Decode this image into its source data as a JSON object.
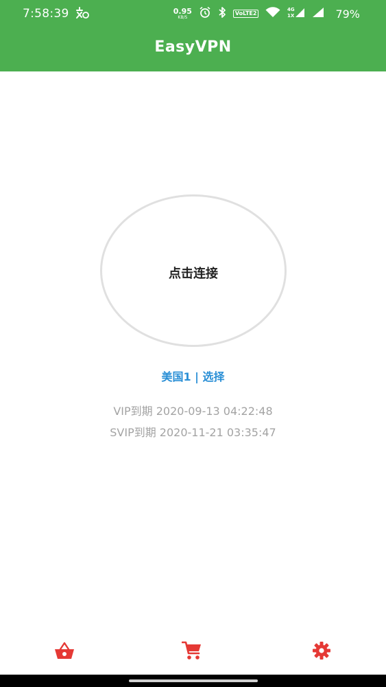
{
  "status_bar": {
    "time": "7:58:39",
    "net_speed_value": "0.95",
    "net_speed_unit": "KB/S",
    "volte_label": "VoLTE2",
    "battery_percent": "79%",
    "icons": [
      "app-notification-icon",
      "alarm-icon",
      "bluetooth-icon",
      "wifi-icon",
      "signal-4g-icon",
      "signal-icon"
    ]
  },
  "app_bar": {
    "title": "EasyVPN"
  },
  "connect": {
    "label": "点击连接"
  },
  "server": {
    "selection_text": "美国1 | 选择"
  },
  "membership": {
    "vip_line": "VIP到期 2020-09-13 04:22:48",
    "svip_line": "SVIP到期 2020-11-21 03:35:47"
  },
  "bottom_nav": {
    "items": [
      {
        "name": "shop-basket",
        "icon": "basket-icon"
      },
      {
        "name": "cart",
        "icon": "shopping-cart-icon"
      },
      {
        "name": "settings",
        "icon": "gear-icon"
      }
    ],
    "accent_color": "#e53935"
  },
  "colors": {
    "app_bar": "#4caf50",
    "link": "#2a8fd6",
    "muted_text": "#a3a3a3",
    "ring_border": "#e0e0e0"
  }
}
